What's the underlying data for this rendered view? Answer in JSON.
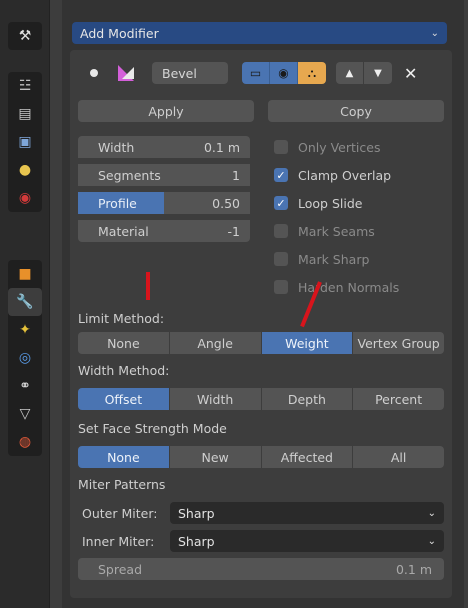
{
  "sidebar": {
    "icons": [
      "tool-icon",
      "render-icon",
      "output-icon",
      "view-layer-icon",
      "scene-icon",
      "world-icon",
      "object-icon",
      "modifier-icon",
      "particles-icon",
      "physics-icon",
      "constraints-icon",
      "data-icon",
      "material-icon"
    ]
  },
  "header": {
    "dropdown_label": "Add Modifier"
  },
  "modifier": {
    "name": "Bevel",
    "apply_label": "Apply",
    "copy_label": "Copy",
    "fields": {
      "width_label": "Width",
      "width_value": "0.1 m",
      "segments_label": "Segments",
      "segments_value": "1",
      "profile_label": "Profile",
      "profile_value": "0.50",
      "material_label": "Material",
      "material_value": "-1"
    },
    "checks": {
      "only_vertices": "Only Vertices",
      "clamp_overlap": "Clamp Overlap",
      "loop_slide": "Loop Slide",
      "mark_seams": "Mark Seams",
      "mark_sharp": "Mark Sharp",
      "harden_normals": "Harden Normals"
    },
    "limit_method_label": "Limit Method:",
    "limit_method_options": [
      "None",
      "Angle",
      "Weight",
      "Vertex Group"
    ],
    "limit_method_selected": "Weight",
    "width_method_label": "Width Method:",
    "width_method_options": [
      "Offset",
      "Width",
      "Depth",
      "Percent"
    ],
    "width_method_selected": "Offset",
    "face_strength_label": "Set Face Strength Mode",
    "face_strength_options": [
      "None",
      "New",
      "Affected",
      "All"
    ],
    "face_strength_selected": "None",
    "miter_patterns_label": "Miter Patterns",
    "outer_miter_label": "Outer Miter:",
    "outer_miter_value": "Sharp",
    "inner_miter_label": "Inner Miter:",
    "inner_miter_value": "Sharp",
    "spread_label": "Spread",
    "spread_value": "0.1 m"
  },
  "colors": {
    "accent": "#4a74b2",
    "header_blue": "#284a83",
    "annotation_red": "#d8141c"
  }
}
